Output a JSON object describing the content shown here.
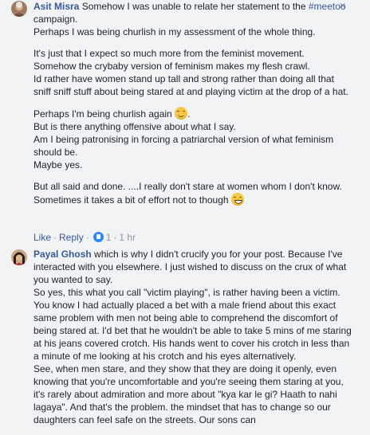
{
  "comment1": {
    "author": "Asit Misra",
    "paragraphs": [
      [
        "Somehow I was unable to relate her statement to the ",
        "#meetoo",
        " campaign.\nPerhaps I was being churlish in my assessment of the whole thing."
      ],
      "It's just that I expect so much more from the feminist movement.\nSomehow the crybaby version of feminism makes my flesh crawl.\nId rather have women stand up tall and strong rather than doing all that sniff sniff stuff about being stared at and playing victim at the drop of a hat.",
      [
        "Perhaps I'm being churlish again ",
        ".\nBut is there anything offensive about what I say.\nAm I being patronising in forcing a patriarchal version of what feminism should be.\nMaybe yes."
      ],
      [
        "But all said and done. ....I really don't stare at women whom I don't know.\nSometimes it takes a bit of effort not to though "
      ]
    ],
    "actions": {
      "like": "Like",
      "reply": "Reply",
      "reactions": "1",
      "time": "1 hr"
    },
    "close_icon": "×"
  },
  "comment2": {
    "author": "Payal Ghosh",
    "text": " which is why I didn't crucify you for your post. Because I've interacted with you elsewhere. I just wished to discuss on the crux of what you wanted to say.\nSo yes, this what you call \"victim playing\", is rather having been a victim. You know I had actually placed a bet with a male friend about this exact same problem with men not being able to comprehend the discomfort of being stared at. I'd bet that he wouldn't be able to take 5 mins of me staring at his jeans covered crotch. His hands went to cover his crotch in less than a minute of me looking at his crotch and his eyes alternatively.\nSee, when men stare, and they show that they are doing it openly, even knowing that you're uncomfortable and you're seeing them staring at you, it's rarely about admiration and more about \"kya kar le gi? Haath to nahi lagaya\". And that's the problem. the mindset that has to change so our daughters can feel safe on the streets. Our sons can"
  }
}
